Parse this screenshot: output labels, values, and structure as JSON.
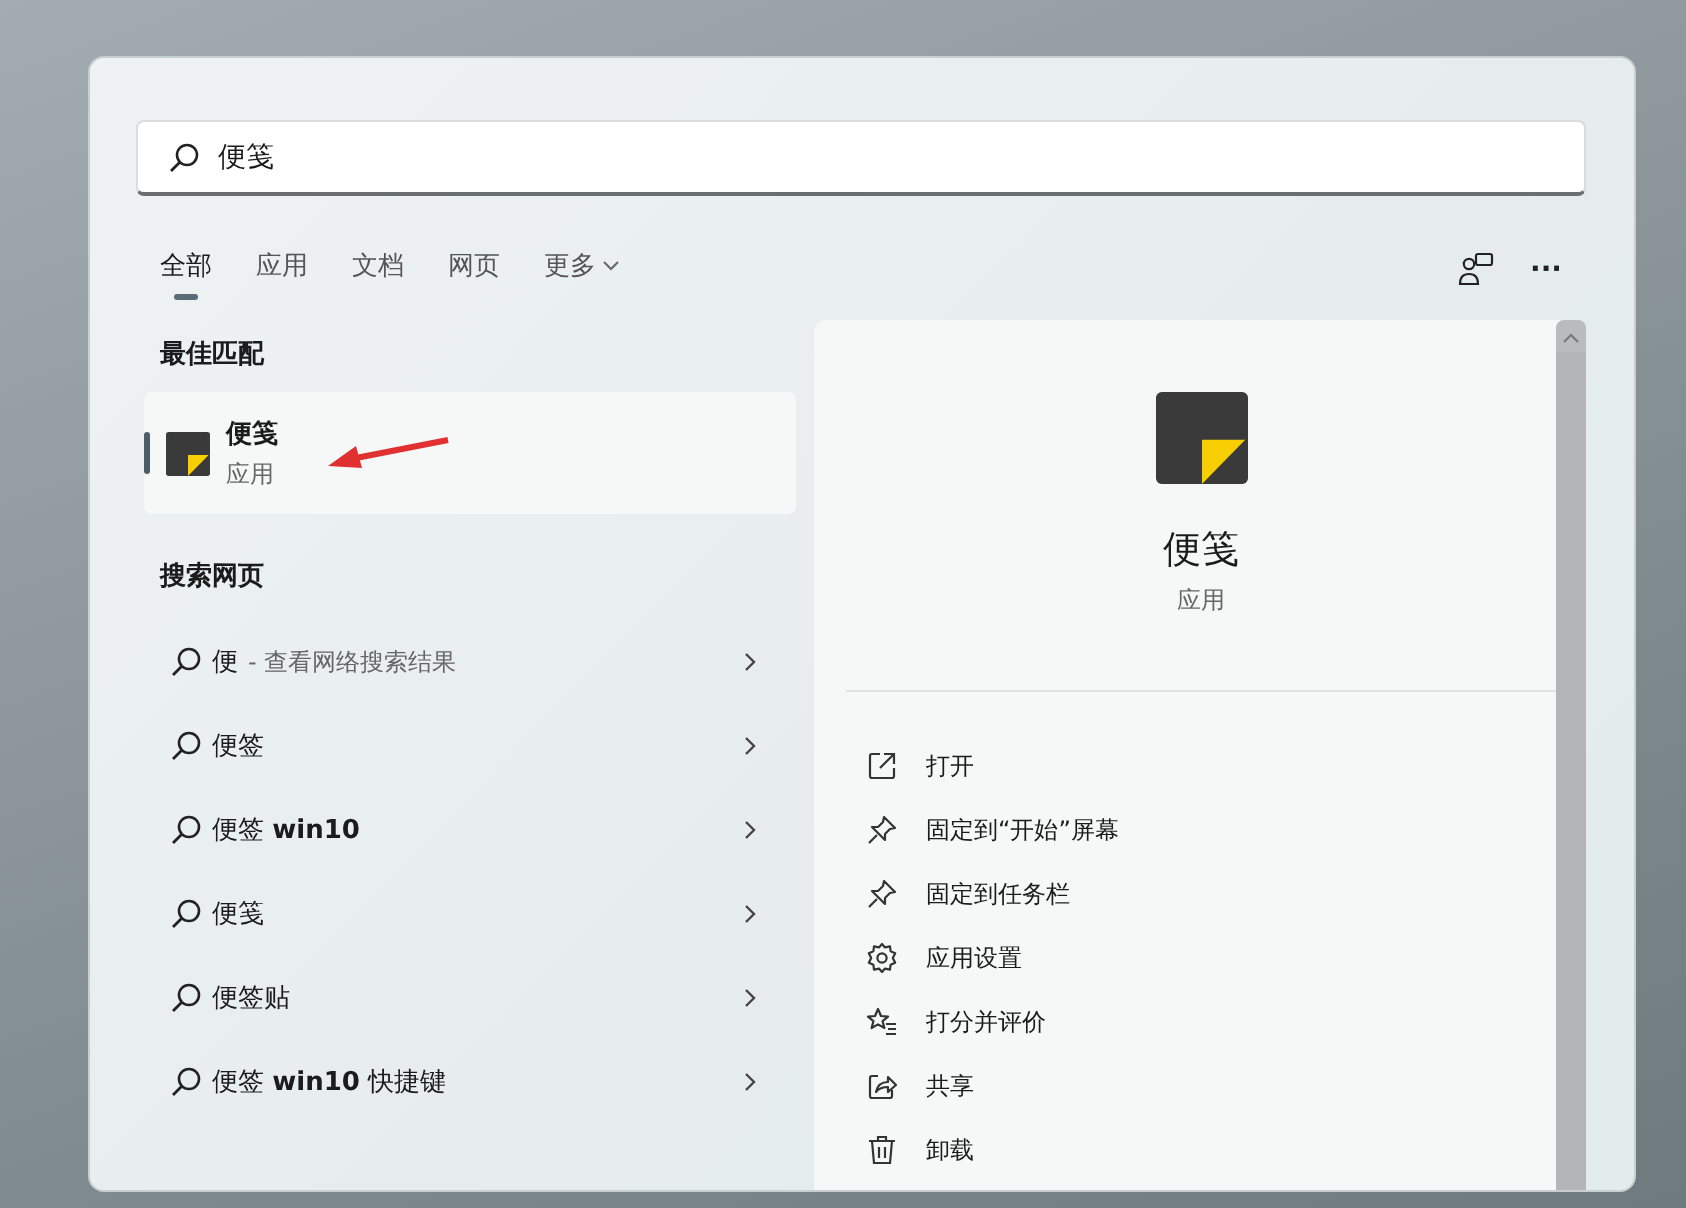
{
  "search": {
    "value": "便笺"
  },
  "tabs": [
    {
      "label": "全部",
      "selected": true,
      "kind": "tab"
    },
    {
      "label": "应用",
      "selected": false,
      "kind": "tab"
    },
    {
      "label": "文档",
      "selected": false,
      "kind": "tab"
    },
    {
      "label": "网页",
      "selected": false,
      "kind": "tab"
    },
    {
      "label": "更多",
      "selected": false,
      "kind": "dropdown"
    }
  ],
  "more_options": "···",
  "best_match": {
    "heading": "最佳匹配",
    "item": {
      "title": "便笺",
      "subtitle": "应用",
      "selected": true
    }
  },
  "web_search": {
    "heading": "搜索网页",
    "items": [
      {
        "text": "便",
        "hint": "- 查看网络搜索结果"
      },
      {
        "text": "便签"
      },
      {
        "text": "便签 **win10**"
      },
      {
        "text": "便笺"
      },
      {
        "text": "便签贴"
      },
      {
        "text": "便签 **win10** 快捷键"
      }
    ]
  },
  "details": {
    "title": "便笺",
    "subtitle": "应用",
    "actions": [
      {
        "label": "打开",
        "kind": "open"
      },
      {
        "label": "固定到“开始”屏幕",
        "kind": "pin"
      },
      {
        "label": "固定到任务栏",
        "kind": "pin"
      },
      {
        "label": "应用设置",
        "kind": "settings"
      },
      {
        "label": "打分并评价",
        "kind": "rate"
      },
      {
        "label": "共享",
        "kind": "share"
      },
      {
        "label": "卸载",
        "kind": "uninstall"
      }
    ]
  }
}
